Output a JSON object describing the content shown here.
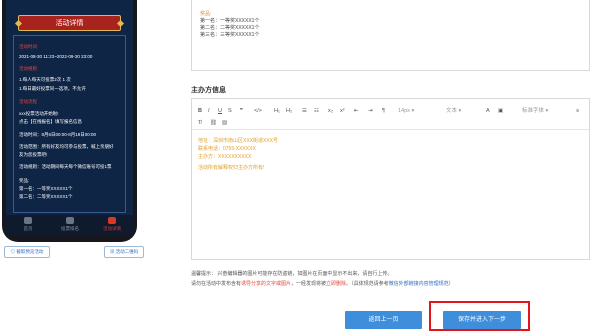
{
  "phone": {
    "header_title": "活动详情",
    "lines": [
      {
        "text": "活动时间",
        "style": "red"
      },
      {
        "text": "2021-08-30 11:23~2022-09-30 23:00",
        "style": "white"
      },
      {
        "text": "活动规则",
        "style": "red"
      },
      {
        "text": "1.每人每天可投票2次 1 次",
        "style": "white"
      },
      {
        "text": "1.每日最好投票同一选项，不允许",
        "style": "white"
      },
      {
        "text": "活动流程",
        "style": "red"
      },
      {
        "text": "xxx投票活动开始啦!",
        "style": "white"
      },
      {
        "text": "点击【在线报名】填写报名信息",
        "style": "white"
      },
      {
        "text": "活动时间：8月6日00:00-8月18日00:00",
        "style": "white"
      },
      {
        "text": "活动范围：所有好友均可参与投票，喊上亲朋好",
        "style": "white"
      },
      {
        "text": "友为您投票吧!",
        "style": "white"
      },
      {
        "text": "活动规则：活动期间每天每个微信账号可投1票",
        "style": "white"
      },
      {
        "text": "奖品:",
        "style": "white"
      },
      {
        "text": "第一名：一等奖XXXXX1个",
        "style": "white"
      },
      {
        "text": "第二名：二等奖XXXXX1个",
        "style": "white"
      }
    ],
    "tabs": [
      {
        "label": "首页",
        "active": false
      },
      {
        "label": "投票排名",
        "active": false
      },
      {
        "label": "活动详情",
        "active": true
      }
    ],
    "left_button": "截取预览活动",
    "right_button": "活动二维码"
  },
  "awards": {
    "heading": "奖品:",
    "lines": [
      "第一名：一等奖XXXXX1个",
      "第二名：二等奖XXXXX1个",
      "第三名：三等奖XXXXX1个"
    ]
  },
  "organizer": {
    "section_title": "主办方信息",
    "toolbar": {
      "font_size": "14px",
      "paragraph": "文本",
      "font_family": "标准字体"
    },
    "lines": [
      "地址：深圳市南山区XXX街道XXX号",
      "联系电话：0755-XXXXXX",
      "主办方：XXXXXXXXXX"
    ],
    "welcome": "活动所有解释权归主办方所有!"
  },
  "tips": {
    "line1": "温馨提示：  兴奋编辑器的图片可能存在防盗链，如图片在页面中显示不出来，请自行上传。",
    "line2_a": "请勿在活动中发布含有",
    "line2_red": "诱导分享的文字或图片",
    "line2_b": "，一经发现将被",
    "line2_red2": "立即删除",
    "line2_c": "。（具体规范请参考",
    "line2_link": "微信外部链接内容管理规范",
    "line2_d": "）"
  },
  "buttons": {
    "prev": "返回上一页",
    "next": "保存并进入下一步"
  },
  "colors": {
    "accent": "#3e8edb",
    "highlight": "#e3141c",
    "phone_bg": "#0e2546",
    "phone_header": "#a8231d"
  }
}
